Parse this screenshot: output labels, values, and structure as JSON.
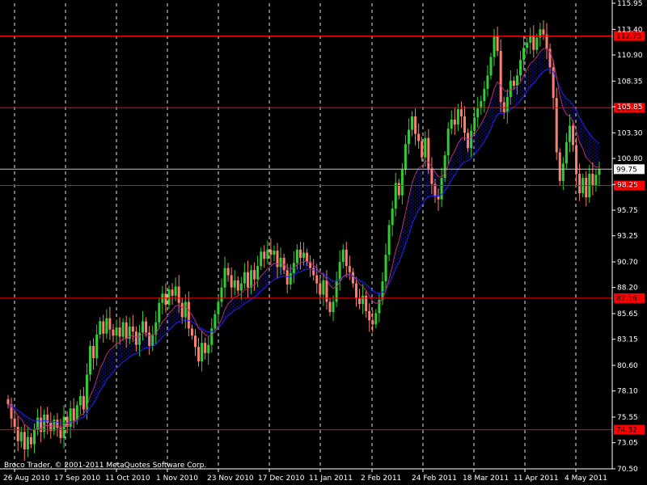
{
  "chart_data": {
    "type": "candlestick",
    "copyright": "Broco Trader, © 2001-2011 MetaQuotes Software Corp.",
    "ylim": [
      70.5,
      115.95
    ],
    "y_ticks": [
      "115.95",
      "113.40",
      "110.90",
      "108.35",
      "105.85",
      "103.30",
      "100.80",
      "98.25",
      "95.75",
      "93.25",
      "90.70",
      "88.20",
      "85.65",
      "83.15",
      "80.60",
      "78.10",
      "75.55",
      "73.05",
      "70.50"
    ],
    "x_ticks": [
      "26 Aug 2010",
      "17 Sep 2010",
      "11 Oct 2010",
      "1 Nov 2010",
      "23 Nov 2010",
      "17 Dec 2010",
      "11 Jan 2011",
      "2 Feb 2011",
      "24 Feb 2011",
      "18 Mar 2011",
      "11 Apr 2011",
      "4 May 2011"
    ],
    "horizontal_levels": [
      {
        "value": 112.75,
        "label": "112.75"
      },
      {
        "value": 105.75,
        "label": "105.75"
      },
      {
        "value": 98.16,
        "label": "98.16"
      },
      {
        "value": 87.16,
        "label": "87.16"
      },
      {
        "value": 74.32,
        "label": "74.32"
      }
    ],
    "current_price": {
      "value": 99.75,
      "label": "99.75"
    },
    "colors": {
      "background": "#000000",
      "bull": "#32cd32",
      "bear": "#fa8072",
      "level_line": "#ff0000",
      "level_box": "#ff0000",
      "price_box": "#ffffff",
      "ma_fast": "#b0306a",
      "ma_slow": "#2222ff",
      "cloud": "#1515c0",
      "grid": "#ffffff"
    },
    "closes": [
      76.8,
      75.4,
      74.6,
      73.2,
      74.1,
      72.4,
      73.6,
      72.9,
      74.3,
      75.5,
      74.1,
      75.8,
      75.0,
      74.2,
      75.3,
      74.5,
      73.5,
      75.6,
      74.6,
      76.4,
      75.2,
      76.7,
      77.6,
      76.3,
      79.7,
      82.5,
      81.3,
      83.6,
      84.9,
      83.7,
      85.2,
      84.1,
      83.5,
      84.3,
      83.4,
      84.8,
      83.2,
      84.4,
      83.9,
      82.6,
      83.8,
      84.9,
      83.8,
      82.5,
      83.6,
      84.8,
      86.7,
      87.6,
      86.5,
      88.0,
      87.4,
      88.3,
      86.7,
      85.3,
      86.8,
      84.2,
      83.5,
      82.4,
      81.0,
      82.8,
      81.8,
      82.6,
      84.2,
      85.6,
      86.8,
      88.2,
      90.1,
      89.4,
      88.2,
      88.9,
      87.9,
      88.6,
      89.7,
      88.2,
      89.9,
      89.0,
      90.3,
      91.7,
      91.0,
      91.9,
      91.4,
      91.8,
      90.2,
      91.1,
      89.9,
      88.5,
      89.6,
      90.6,
      91.9,
      91.1,
      91.6,
      90.7,
      90.1,
      89.4,
      88.6,
      87.5,
      88.9,
      86.8,
      85.8,
      86.8,
      88.9,
      90.7,
      91.9,
      90.3,
      89.7,
      88.6,
      87.2,
      86.6,
      87.4,
      85.9,
      85.0,
      84.6,
      85.7,
      87.0,
      88.8,
      91.4,
      94.3,
      95.9,
      98.4,
      97.2,
      99.7,
      102.2,
      103.6,
      104.9,
      103.2,
      102.5,
      100.9,
      102.8,
      99.8,
      98.3,
      97.1,
      96.8,
      98.9,
      101.1,
      103.7,
      104.6,
      104.1,
      105.6,
      104.9,
      103.3,
      101.8,
      103.5,
      104.8,
      105.7,
      106.4,
      107.6,
      108.9,
      110.7,
      112.8,
      111.3,
      106.3,
      105.3,
      106.8,
      108.4,
      107.9,
      108.9,
      110.4,
      111.6,
      112.1,
      112.8,
      111.4,
      112.6,
      113.4,
      112.9,
      111.5,
      109.7,
      106.7,
      101.4,
      98.6,
      100.3,
      102.4,
      104.0,
      102.1,
      99.3,
      97.4,
      98.9,
      97.0,
      99.3,
      98.2,
      99.2,
      99.75
    ]
  }
}
